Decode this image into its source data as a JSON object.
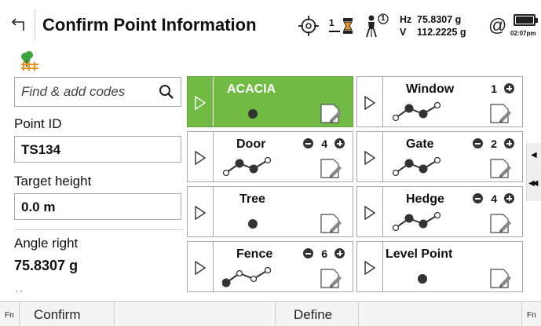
{
  "header": {
    "title": "Confirm Point Information",
    "prism_constant": "1",
    "instrument_face": "1",
    "hz_label": "Hz",
    "hz_value": "75.8307 g",
    "v_label": "V",
    "v_value": "112.2225 g",
    "status_symbol": "@",
    "time": "02:07pm"
  },
  "icons": {
    "back": "back-arrow-icon",
    "target": "crosshair-target-icon",
    "prism": "prism-icon",
    "surveyor": "surveyor-icon",
    "battery": "battery-icon",
    "code": "tree-fence-code-icon",
    "search": "search-icon",
    "edit": "edit-pencil-icon"
  },
  "left_panel": {
    "search_placeholder": "Find & add codes",
    "point_id_label": "Point ID",
    "point_id_value": "TS134",
    "target_height_label": "Target height",
    "target_height_value": "0.0 m",
    "angle_right_label": "Angle right",
    "angle_right_value": "75.8307 g",
    "more_indicator": ", ,"
  },
  "codes": [
    {
      "name": "ACACIA",
      "type": "point",
      "active": true,
      "count": null
    },
    {
      "name": "Window",
      "type": "line",
      "active": false,
      "count": "1",
      "show_minus": false
    },
    {
      "name": "Door",
      "type": "line",
      "active": false,
      "count": "4",
      "show_minus": true
    },
    {
      "name": "Gate",
      "type": "line",
      "active": false,
      "count": "2",
      "show_minus": true
    },
    {
      "name": "Tree",
      "type": "point",
      "active": false,
      "count": null
    },
    {
      "name": "Hedge",
      "type": "line",
      "active": false,
      "count": "4",
      "show_minus": true
    },
    {
      "name": "Fence",
      "type": "line-alt",
      "active": false,
      "count": "6",
      "show_minus": true
    },
    {
      "name": "Level Point",
      "type": "point",
      "active": false,
      "count": null
    }
  ],
  "colors": {
    "active_card": "#71bb45",
    "code_icon_green": "#3ca23c",
    "code_icon_orange": "#e8901e"
  },
  "bottom_bar": {
    "fn_left": "Fn",
    "confirm": "Confirm",
    "define": "Define",
    "fn_right": "Fn"
  },
  "side_arrows": {
    "up": "◀",
    "double": "◀◀"
  }
}
